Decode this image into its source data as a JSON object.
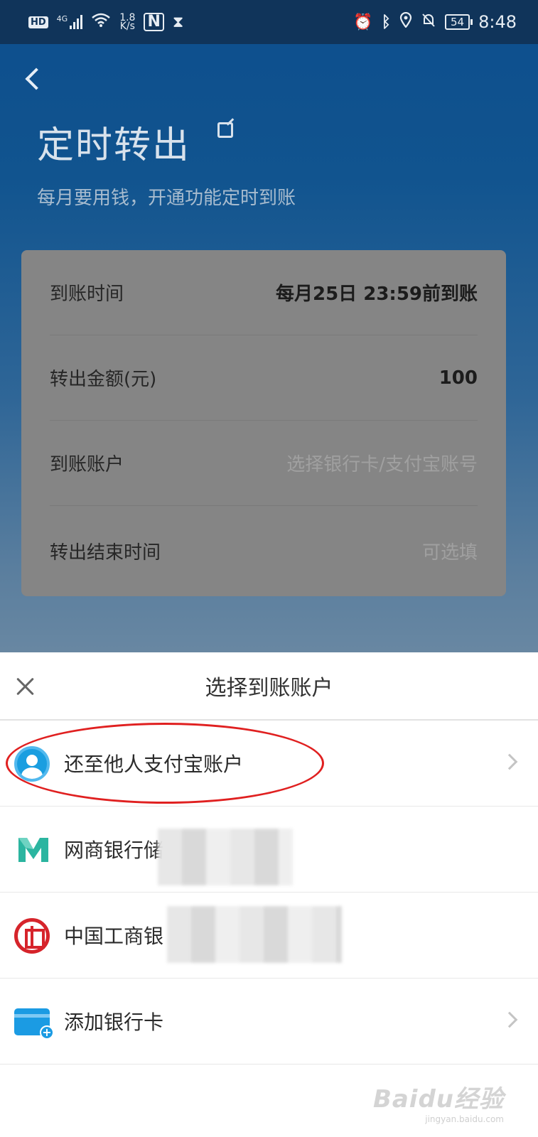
{
  "status_bar": {
    "hd": "HD",
    "network": "4G",
    "speed_value": "1.8",
    "speed_unit": "K/s",
    "nfc": "N",
    "battery": "54",
    "time": "8:48"
  },
  "page": {
    "title": "定时转出",
    "subtitle": "每月要用钱，开通功能定时到账"
  },
  "form": {
    "rows": [
      {
        "label": "到账时间",
        "value": "每月25日 23:59前到账"
      },
      {
        "label": "转出金额(元)",
        "value": "100"
      },
      {
        "label": "到账账户",
        "placeholder": "选择银行卡/支付宝账号"
      },
      {
        "label": "转出结束时间",
        "placeholder": "可选填"
      }
    ]
  },
  "sheet": {
    "title": "选择到账账户",
    "items": [
      {
        "label": "还至他人支付宝账户",
        "icon": "user-avatar-icon"
      },
      {
        "label": "网商银行储",
        "icon": "mybank-icon"
      },
      {
        "label": "中国工商银",
        "icon": "icbc-icon"
      },
      {
        "label": "添加银行卡",
        "icon": "add-card-icon"
      }
    ]
  },
  "watermark": {
    "logo": "Baidu经验",
    "url": "jingyan.baidu.com"
  },
  "colors": {
    "accent_blue": "#1a9ee0",
    "annotation_red": "#e02020",
    "icbc_red": "#d6242b",
    "mybank_green": "#2bb5a0"
  }
}
